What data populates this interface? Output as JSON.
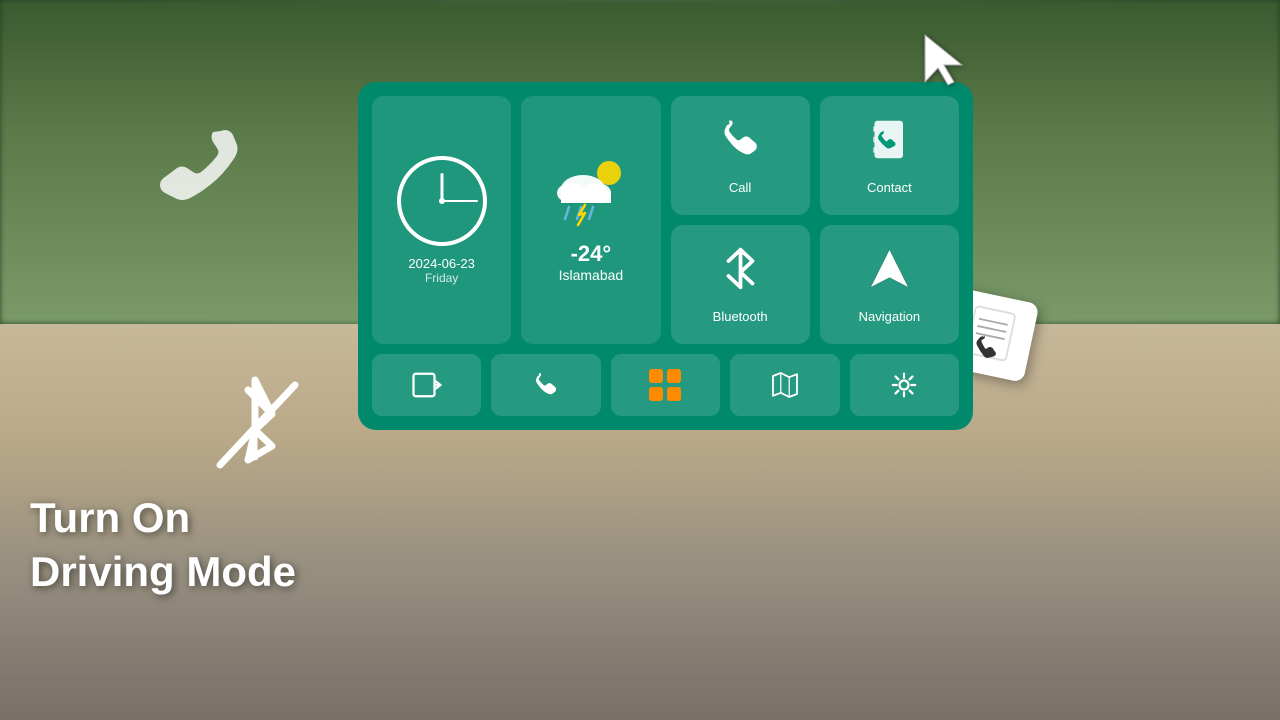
{
  "background": {
    "top_color": "#4a6a3a",
    "bottom_color": "#b8a888"
  },
  "overlay_icons": {
    "phone_topleft": "📞",
    "bluetooth_left": "✱",
    "driving_mode_line1": "Turn On",
    "driving_mode_line2": "Driving Mode"
  },
  "screen": {
    "bg_color": "#00896a",
    "clock_tile": {
      "date": "2024-06-23",
      "day": "Friday"
    },
    "weather_tile": {
      "temperature": "-24°",
      "city": "Islamabad",
      "icon": "⛅🌧"
    },
    "tiles": [
      {
        "id": "call",
        "icon": "📞",
        "label": "Call"
      },
      {
        "id": "contact",
        "icon": "📖",
        "label": "Contact"
      },
      {
        "id": "bluetooth",
        "icon": "bluetooth",
        "label": "Bluetooth"
      },
      {
        "id": "navigation",
        "icon": "navigation",
        "label": "Navigation"
      }
    ],
    "nav_buttons": [
      {
        "id": "back",
        "icon": "exit"
      },
      {
        "id": "phone",
        "icon": "📞"
      },
      {
        "id": "apps",
        "icon": "grid"
      },
      {
        "id": "map",
        "icon": "🗺"
      },
      {
        "id": "settings",
        "icon": "⚙"
      }
    ]
  }
}
